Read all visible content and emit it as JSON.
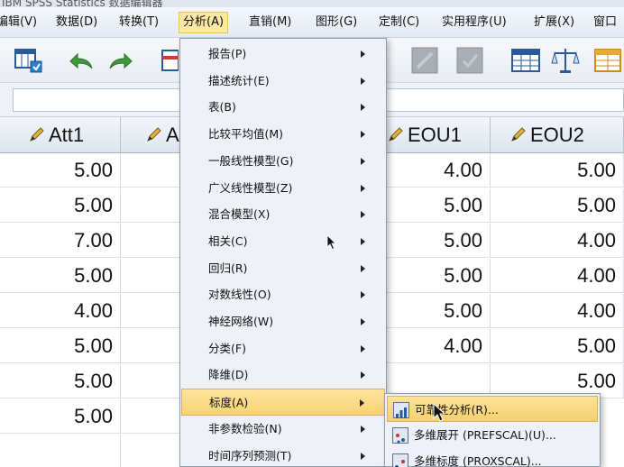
{
  "window": {
    "title": "IBM SPSS Statistics 数据编辑器"
  },
  "menubar": {
    "items": [
      {
        "label": "编辑(V)"
      },
      {
        "label": "数据(D)"
      },
      {
        "label": "转换(T)"
      },
      {
        "label": "分析(A)",
        "active": true
      },
      {
        "label": "直销(M)"
      },
      {
        "label": "图形(G)"
      },
      {
        "label": "实用程序(U)"
      },
      {
        "label": "扩展(X)"
      },
      {
        "label": "窗口"
      }
    ],
    "extra_label": "定制(C)"
  },
  "grid": {
    "columns": [
      {
        "label": "Att1",
        "icon": "pencil-icon"
      },
      {
        "label": "A",
        "icon": "pencil-icon"
      },
      {
        "label": "",
        "icon": ""
      },
      {
        "label": "EOU1",
        "icon": "pencil-icon"
      },
      {
        "label": "EOU2",
        "icon": "pencil-icon"
      }
    ],
    "rows": [
      [
        "5.00",
        "4.00",
        "5.00"
      ],
      [
        "5.00",
        "5.00",
        "5.00"
      ],
      [
        "7.00",
        "5.00",
        "4.00"
      ],
      [
        "5.00",
        "5.00",
        "4.00"
      ],
      [
        "4.00",
        "5.00",
        "4.00"
      ],
      [
        "5.00",
        "4.00",
        "5.00"
      ],
      [
        "5.00",
        "",
        "5.00"
      ],
      [
        "5.00",
        "",
        ""
      ]
    ]
  },
  "analyze_menu": {
    "items": [
      {
        "label": "报告(P)"
      },
      {
        "label": "描述统计(E)"
      },
      {
        "label": "表(B)"
      },
      {
        "label": "比较平均值(M)"
      },
      {
        "label": "一般线性模型(G)"
      },
      {
        "label": "广义线性模型(Z)"
      },
      {
        "label": "混合模型(X)"
      },
      {
        "label": "相关(C)"
      },
      {
        "label": "回归(R)"
      },
      {
        "label": "对数线性(O)"
      },
      {
        "label": "神经网络(W)"
      },
      {
        "label": "分类(F)"
      },
      {
        "label": "降维(D)"
      },
      {
        "label": "标度(A)",
        "highlight": true
      },
      {
        "label": "非参数检验(N)"
      },
      {
        "label": "时间序列预测(T)"
      }
    ]
  },
  "scale_submenu": {
    "items": [
      {
        "label": "可靠性分析(R)...",
        "icon": "reliability-icon",
        "highlight": true
      },
      {
        "label": "多维展开 (PREFSCAL)(U)...",
        "icon": "prefscal-icon"
      },
      {
        "label": "多维标度 (PROXSCAL)...",
        "icon": "proxscal-icon"
      }
    ]
  },
  "colors": {
    "highlight": "#f8d276",
    "menu_bg": "#eef2f8",
    "header_bg": "#dde5ee"
  }
}
